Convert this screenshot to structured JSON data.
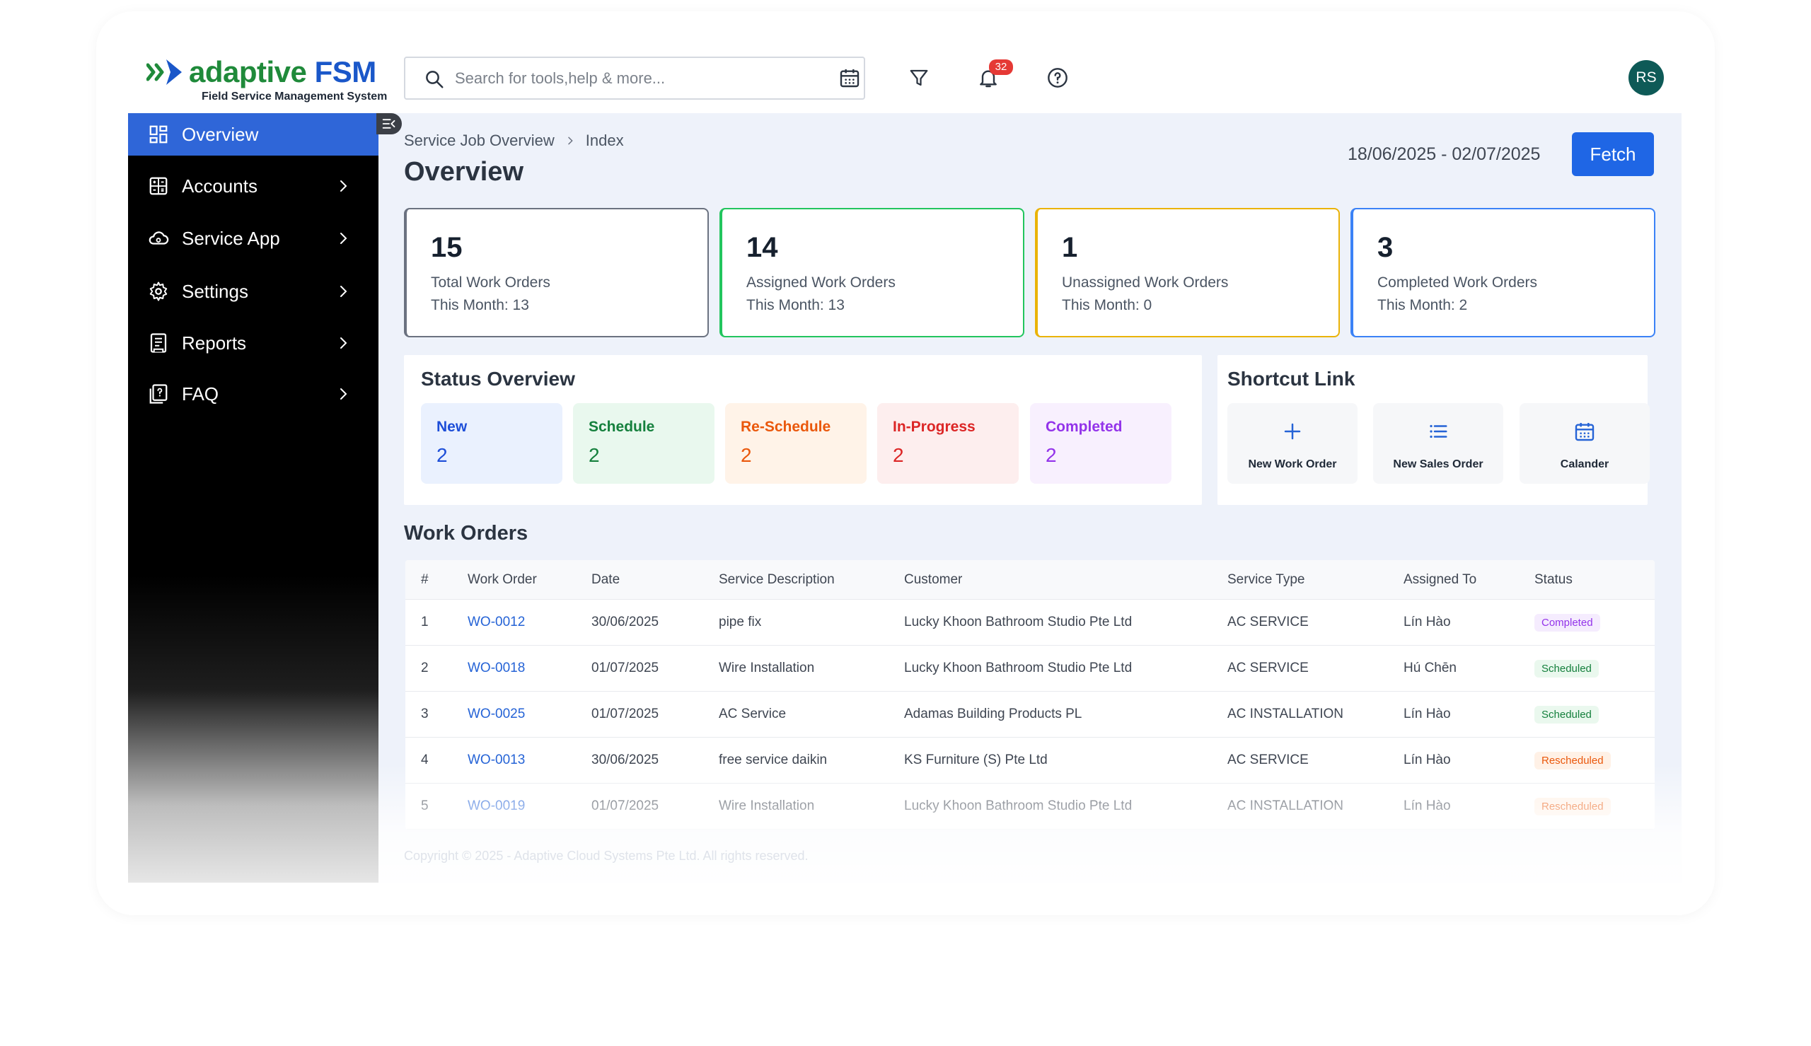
{
  "header": {
    "logo_main_1": "adaptive",
    "logo_main_2": " FSM",
    "logo_sub": "Field Service Management System",
    "search_placeholder": "Search for tools,help & more...",
    "notification_count": "32",
    "avatar_initials": "RS"
  },
  "sidebar": {
    "items": [
      {
        "label": "Overview",
        "icon": "dashboard-icon"
      },
      {
        "label": "Accounts",
        "icon": "accounts-icon"
      },
      {
        "label": "Service App",
        "icon": "service-app-icon"
      },
      {
        "label": "Settings",
        "icon": "gear-icon"
      },
      {
        "label": "Reports",
        "icon": "reports-icon"
      },
      {
        "label": "FAQ",
        "icon": "faq-icon"
      }
    ]
  },
  "main": {
    "breadcrumb": [
      "Service Job Overview",
      "Index"
    ],
    "title": "Overview",
    "date_range": "18/06/2025 - 02/07/2025",
    "fetch_label": "Fetch",
    "stats": [
      {
        "value": "15",
        "label": "Total Work Orders",
        "sub": "This Month: 13",
        "color": "#6b7280"
      },
      {
        "value": "14",
        "label": "Assigned Work Orders",
        "sub": "This Month: 13",
        "color": "#22c55e"
      },
      {
        "value": "1",
        "label": "Unassigned Work Orders",
        "sub": "This Month: 0",
        "color": "#eab308"
      },
      {
        "value": "3",
        "label": "Completed Work Orders",
        "sub": "This Month: 2",
        "color": "#3b82f6"
      }
    ],
    "status_overview": {
      "title": "Status Overview",
      "items": [
        {
          "label": "New",
          "value": "2",
          "color": "#1d4ed8",
          "bg": "#eaf1fe"
        },
        {
          "label": "Schedule",
          "value": "2",
          "color": "#15803d",
          "bg": "#e9f8ee"
        },
        {
          "label": "Re-Schedule",
          "value": "2",
          "color": "#ea580c",
          "bg": "#fff3e8"
        },
        {
          "label": "In-Progress",
          "value": "2",
          "color": "#dc2626",
          "bg": "#fdeeee"
        },
        {
          "label": "Completed",
          "value": "2",
          "color": "#9333ea",
          "bg": "#f8f0fe"
        }
      ]
    },
    "shortcuts": {
      "title": "Shortcut Link",
      "items": [
        {
          "label": "New Work Order",
          "icon": "plus-icon"
        },
        {
          "label": "New Sales Order",
          "icon": "list-icon"
        },
        {
          "label": "Calander",
          "icon": "calendar-icon"
        }
      ]
    },
    "work_orders": {
      "title": "Work Orders",
      "columns": [
        "#",
        "Work Order",
        "Date",
        "Service Description",
        "Customer",
        "Service Type",
        "Assigned To",
        "Status"
      ],
      "rows": [
        [
          "1",
          "WO-0012",
          "30/06/2025",
          "pipe fix",
          "Lucky Khoon Bathroom Studio Pte Ltd",
          "AC SERVICE",
          "Lín Hào",
          "Completed"
        ],
        [
          "2",
          "WO-0018",
          "01/07/2025",
          "Wire Installation",
          "Lucky Khoon Bathroom Studio Pte Ltd",
          "AC SERVICE",
          "Hú Chēn",
          "Scheduled"
        ],
        [
          "3",
          "WO-0025",
          "01/07/2025",
          "AC Service",
          "Adamas Building Products PL",
          "AC INSTALLATION",
          "Lín Hào",
          "Scheduled"
        ],
        [
          "4",
          "WO-0013",
          "30/06/2025",
          "free service daikin",
          "KS Furniture (S) Pte Ltd",
          "AC SERVICE",
          "Lín Hào",
          "Rescheduled"
        ],
        [
          "5",
          "WO-0019",
          "01/07/2025",
          "Wire Installation",
          "Lucky Khoon Bathroom Studio Pte Ltd",
          "AC INSTALLATION",
          "Lín Hào",
          "Rescheduled"
        ]
      ],
      "status_colors": {
        "Completed": {
          "fg": "#9333ea",
          "bg": "#f5ecfe"
        },
        "Scheduled": {
          "fg": "#15803d",
          "bg": "#eaf8ee"
        },
        "Rescheduled": {
          "fg": "#ea580c",
          "bg": "#fff1e6"
        }
      }
    },
    "copyright": "Copyright © 2025 - Adaptive Cloud Systems Pte Ltd. All rights reserved."
  }
}
